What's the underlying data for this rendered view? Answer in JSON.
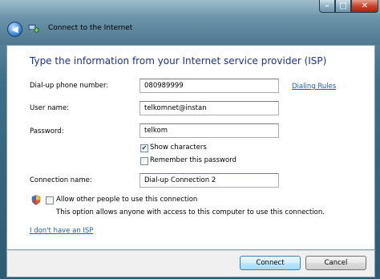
{
  "window": {
    "title": "Connect to the Internet",
    "min_glyph": "–",
    "max_glyph": "□",
    "close_glyph": "✕"
  },
  "heading": "Type the information from your Internet service provider (ISP)",
  "form": {
    "phone_label": "Dial-up phone number:",
    "phone_value": "080989999",
    "dialing_rules_link": "Dialing Rules",
    "username_label": "User name:",
    "username_value": "telkomnet@instan",
    "password_label": "Password:",
    "password_value": "telkom",
    "show_characters": {
      "label": "Show characters",
      "checked": true
    },
    "remember_password": {
      "label": "Remember this password",
      "checked": false
    },
    "connection_label": "Connection name:",
    "connection_value": "Dial-up Connection 2",
    "allow_others": {
      "label": "Allow other people to use this connection",
      "checked": false
    },
    "allow_others_desc": "This option allows anyone with access to this computer to use this connection."
  },
  "no_isp_link": "I don't have an ISP",
  "buttons": {
    "connect": "Connect",
    "cancel": "Cancel"
  }
}
